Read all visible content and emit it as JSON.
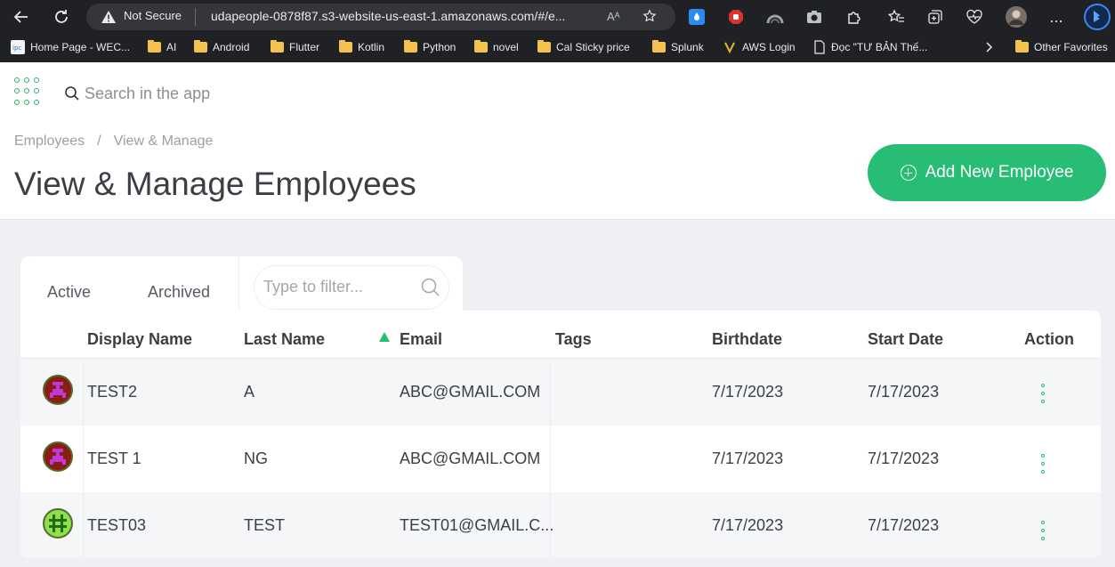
{
  "browser": {
    "url_security": "Not Secure",
    "url": "udapeople-0878f87.s3-website-us-east-1.amazonaws.com/#/e...",
    "reader_icon_label": "Aᴬ",
    "bookmarks": [
      {
        "label": "Home Page - WEC...",
        "icon": "site-icon"
      },
      {
        "label": "AI",
        "icon": "folder-icon"
      },
      {
        "label": "Android",
        "icon": "folder-icon"
      },
      {
        "label": "Flutter",
        "icon": "folder-icon"
      },
      {
        "label": "Kotlin",
        "icon": "folder-icon"
      },
      {
        "label": "Python",
        "icon": "folder-icon"
      },
      {
        "label": "novel",
        "icon": "folder-icon"
      },
      {
        "label": "Cal Sticky price",
        "icon": "folder-icon"
      },
      {
        "label": "Splunk",
        "icon": "folder-icon"
      },
      {
        "label": "AWS Login",
        "icon": "aws-icon"
      },
      {
        "label": "Đọc \"TƯ BẢN Thế...",
        "icon": "page-icon"
      },
      {
        "label": "Other Favorites",
        "icon": "folder-icon"
      }
    ],
    "more_label": "..."
  },
  "app": {
    "search_placeholder": "Search in the app",
    "breadcrumb": [
      "Employees",
      "/",
      "View & Manage"
    ],
    "page_title": "View & Manage Employees",
    "add_button_label": "Add New Employee",
    "tabs": [
      "Active",
      "Archived"
    ],
    "filter_placeholder": "Type to filter...",
    "accent_color": "#27bd74"
  },
  "table": {
    "columns": [
      "Display Name",
      "Last Name",
      "Email",
      "Tags",
      "Birthdate",
      "Start Date",
      "Action"
    ],
    "sorted_column": "Email",
    "rows": [
      {
        "display_name": "TEST2",
        "last_name": "A",
        "email": "ABC@GMAIL.COM",
        "tags": "",
        "birthdate": "7/17/2023",
        "start_date": "7/17/2023",
        "avatar_color": "#c03ad8"
      },
      {
        "display_name": "TEST 1",
        "last_name": "NG",
        "email": "ABC@GMAIL.COM",
        "tags": "",
        "birthdate": "7/17/2023",
        "start_date": "7/17/2023",
        "avatar_color": "#c03ad8"
      },
      {
        "display_name": "TEST03",
        "last_name": "TEST",
        "email": "TEST01@GMAIL.C...",
        "tags": "",
        "birthdate": "7/17/2023",
        "start_date": "7/17/2023",
        "avatar_color": "#8fe04a"
      }
    ]
  }
}
